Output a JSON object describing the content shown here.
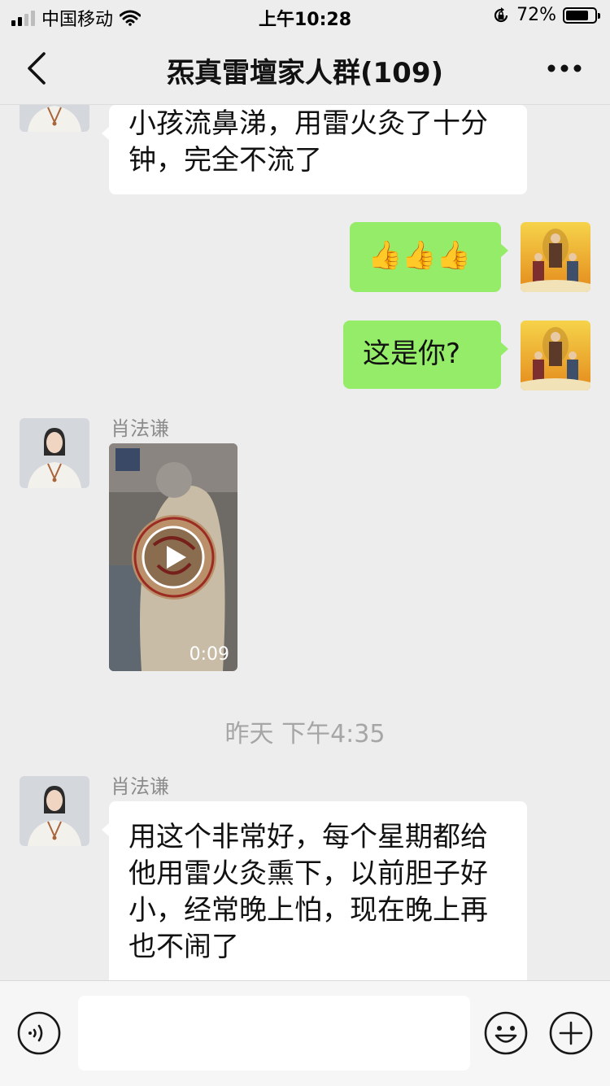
{
  "status_bar": {
    "carrier": "中国移动",
    "time": "上午10:28",
    "battery": "72%"
  },
  "nav": {
    "title": "炁真雷壇家人群",
    "member_count": "(109)"
  },
  "messages": {
    "m1": {
      "text": "小孩流鼻涕，用雷火灸了十分钟，完全不流了"
    },
    "m2": {
      "text": "👍👍👍"
    },
    "m3": {
      "text": "这是你?"
    },
    "m4": {
      "sender": "肖法谦",
      "video_duration": "0:09"
    },
    "timestamp": "昨天 下午4:35",
    "m5": {
      "sender": "肖法谦",
      "text": "用这个非常好，每个星期都给他用雷火灸熏下，以前胆子好小，经常晚上怕，现在晚上再也不闹了"
    }
  },
  "icons": {
    "back": "chevron-left-icon",
    "more": "more-dots-icon",
    "voice": "voice-icon",
    "emoji": "emoji-icon",
    "plus": "plus-icon",
    "play": "play-icon",
    "wifi": "wifi-icon",
    "lock_rotation": "rotation-lock-icon"
  },
  "colors": {
    "background": "#ededed",
    "outgoing_bubble": "#95ec69",
    "incoming_bubble": "#ffffff",
    "secondary_text": "#8c8c8c"
  }
}
